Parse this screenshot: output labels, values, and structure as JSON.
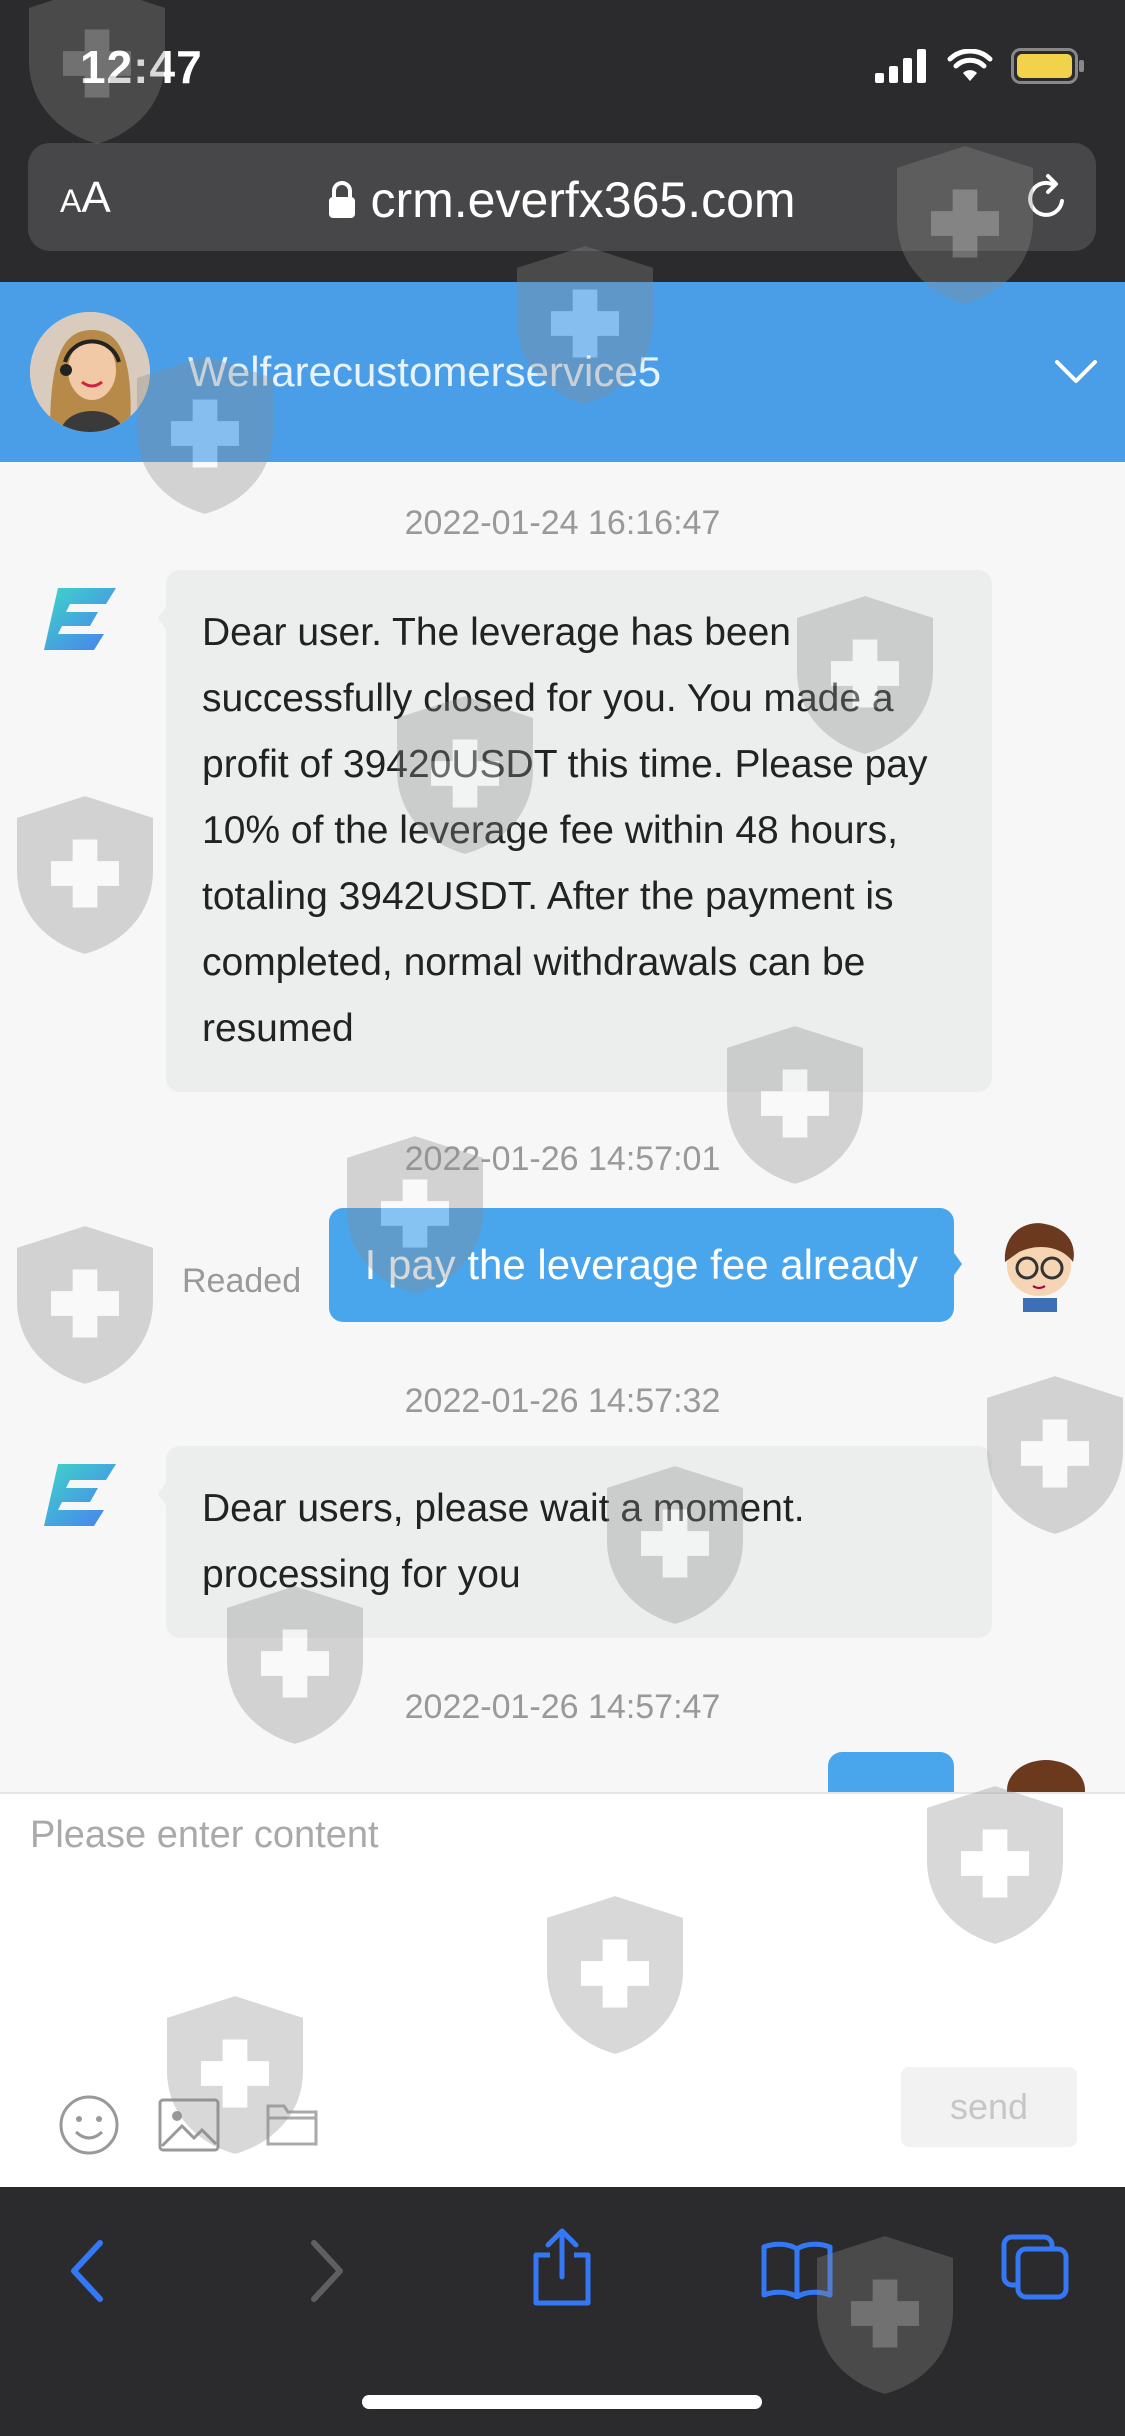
{
  "status_bar": {
    "time": "12:47"
  },
  "browser": {
    "text_size_button": {
      "small": "A",
      "large": "A"
    },
    "url": "crm.everfx365.com"
  },
  "chat": {
    "agent_name": "Welfarecustomerservice5",
    "messages": [
      {
        "timestamp": "2022-01-24 16:16:47",
        "from": "agent",
        "text": "Dear user. The leverage has been successfully closed for you. You made a profit of 39420USDT this time. Please pay 10% of the leverage fee within 48 hours, totaling 3942USDT. After the payment is completed, normal withdrawals can be resumed"
      },
      {
        "timestamp": "2022-01-26 14:57:01",
        "from": "user",
        "text": "I pay the leverage fee already",
        "status": "Readed"
      },
      {
        "timestamp": "2022-01-26 14:57:32",
        "from": "agent",
        "text": "Dear users, please wait a moment. processing for you"
      },
      {
        "timestamp": "2022-01-26 14:57:47",
        "from": "user",
        "text": ""
      }
    ]
  },
  "composer": {
    "placeholder": "Please enter content",
    "send_label": "send"
  },
  "colors": {
    "header_blue": "#4a9ee8",
    "outgoing_bubble": "#4aa6ec",
    "incoming_bubble": "#eceeee",
    "ios_accent": "#3478f6"
  }
}
